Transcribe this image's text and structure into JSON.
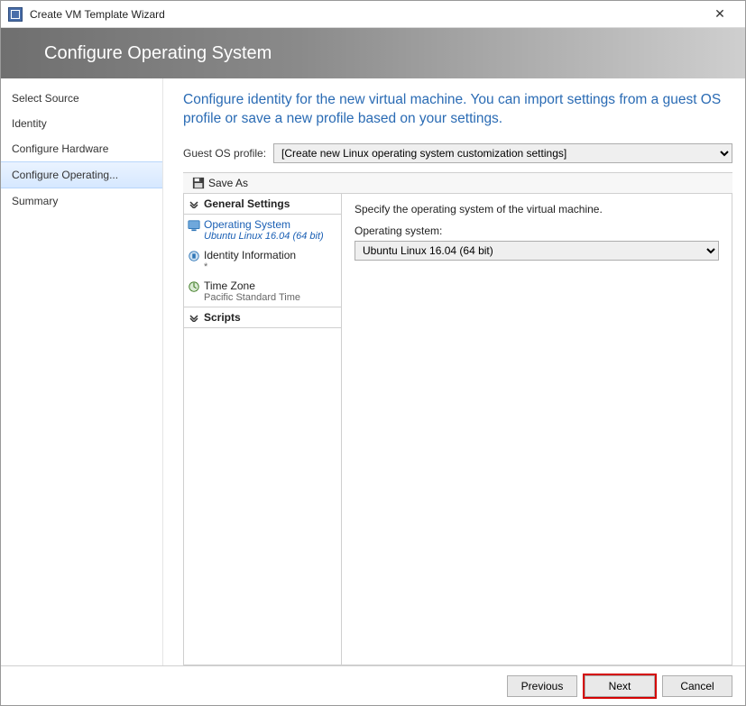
{
  "window": {
    "title": "Create VM Template Wizard"
  },
  "banner": {
    "title": "Configure Operating System"
  },
  "nav": {
    "items": [
      {
        "label": "Select Source",
        "selected": false
      },
      {
        "label": "Identity",
        "selected": false
      },
      {
        "label": "Configure Hardware",
        "selected": false
      },
      {
        "label": "Configure Operating...",
        "selected": true
      },
      {
        "label": "Summary",
        "selected": false
      }
    ]
  },
  "intro": "Configure identity for the new virtual machine. You can import settings from a guest OS profile or save a new profile based on your settings.",
  "guest_profile": {
    "label": "Guest OS profile:",
    "value": "[Create new Linux operating system customization settings]"
  },
  "toolbar": {
    "save_as": "Save As"
  },
  "tree": {
    "sections": [
      {
        "header": "General Settings",
        "items": [
          {
            "title": "Operating System",
            "sub": "Ubuntu Linux 16.04 (64 bit)",
            "icon": "os-icon",
            "selected": true
          },
          {
            "title": "Identity Information",
            "sub": "*",
            "icon": "identity-icon",
            "selected": false
          },
          {
            "title": "Time Zone",
            "sub": "Pacific Standard Time",
            "icon": "timezone-icon",
            "selected": false
          }
        ]
      },
      {
        "header": "Scripts",
        "items": []
      }
    ]
  },
  "detail": {
    "hint": "Specify the operating system of the virtual machine.",
    "os_label": "Operating system:",
    "os_value": "Ubuntu Linux 16.04 (64 bit)"
  },
  "footer": {
    "previous": "Previous",
    "next": "Next",
    "cancel": "Cancel"
  }
}
